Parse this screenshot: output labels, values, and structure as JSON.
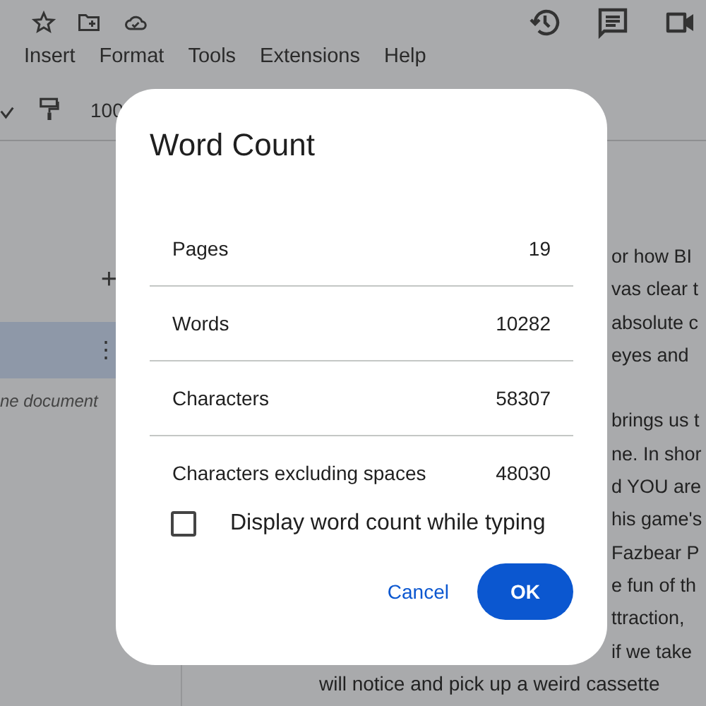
{
  "menu": [
    "Insert",
    "Format",
    "Tools",
    "Extensions",
    "Help"
  ],
  "toolbar": {
    "zoom": "100"
  },
  "outline": {
    "add": "+",
    "more": "⋮",
    "hint": "ne document"
  },
  "document": {
    "lines": [
      {
        "text": "or how BI",
        "kind": "partial"
      },
      {
        "text": "vas clear t",
        "kind": "partial"
      },
      {
        "text": "absolute c",
        "kind": "partial"
      },
      {
        "text": "eyes and",
        "kind": "partial"
      },
      {
        "kind": "gap"
      },
      {
        "text": "brings us t",
        "kind": "partial"
      },
      {
        "text": "ne. In shor",
        "kind": "partial"
      },
      {
        "text": "d YOU are",
        "kind": "partial"
      },
      {
        "text": "his game's",
        "kind": "partial"
      },
      {
        "text": "Fazbear P",
        "kind": "partial"
      },
      {
        "text": "e fun of th",
        "kind": "partial"
      },
      {
        "text": "ttraction,",
        "kind": "partial"
      },
      {
        "text": "if we take",
        "kind": "partial"
      },
      {
        "text": "will notice and pick up a weird cassette",
        "kind": "full"
      }
    ]
  },
  "dialog": {
    "title": "Word Count",
    "rows": [
      {
        "label": "Pages",
        "value": "19"
      },
      {
        "label": "Words",
        "value": "10282"
      },
      {
        "label": "Characters",
        "value": "58307"
      },
      {
        "label": "Characters excluding spaces",
        "value": "48030"
      }
    ],
    "checkbox": {
      "label": "Display word count while typing",
      "checked": false
    },
    "buttons": [
      {
        "label": "Cancel",
        "kind": "text"
      },
      {
        "label": "OK",
        "kind": "primary"
      }
    ]
  }
}
